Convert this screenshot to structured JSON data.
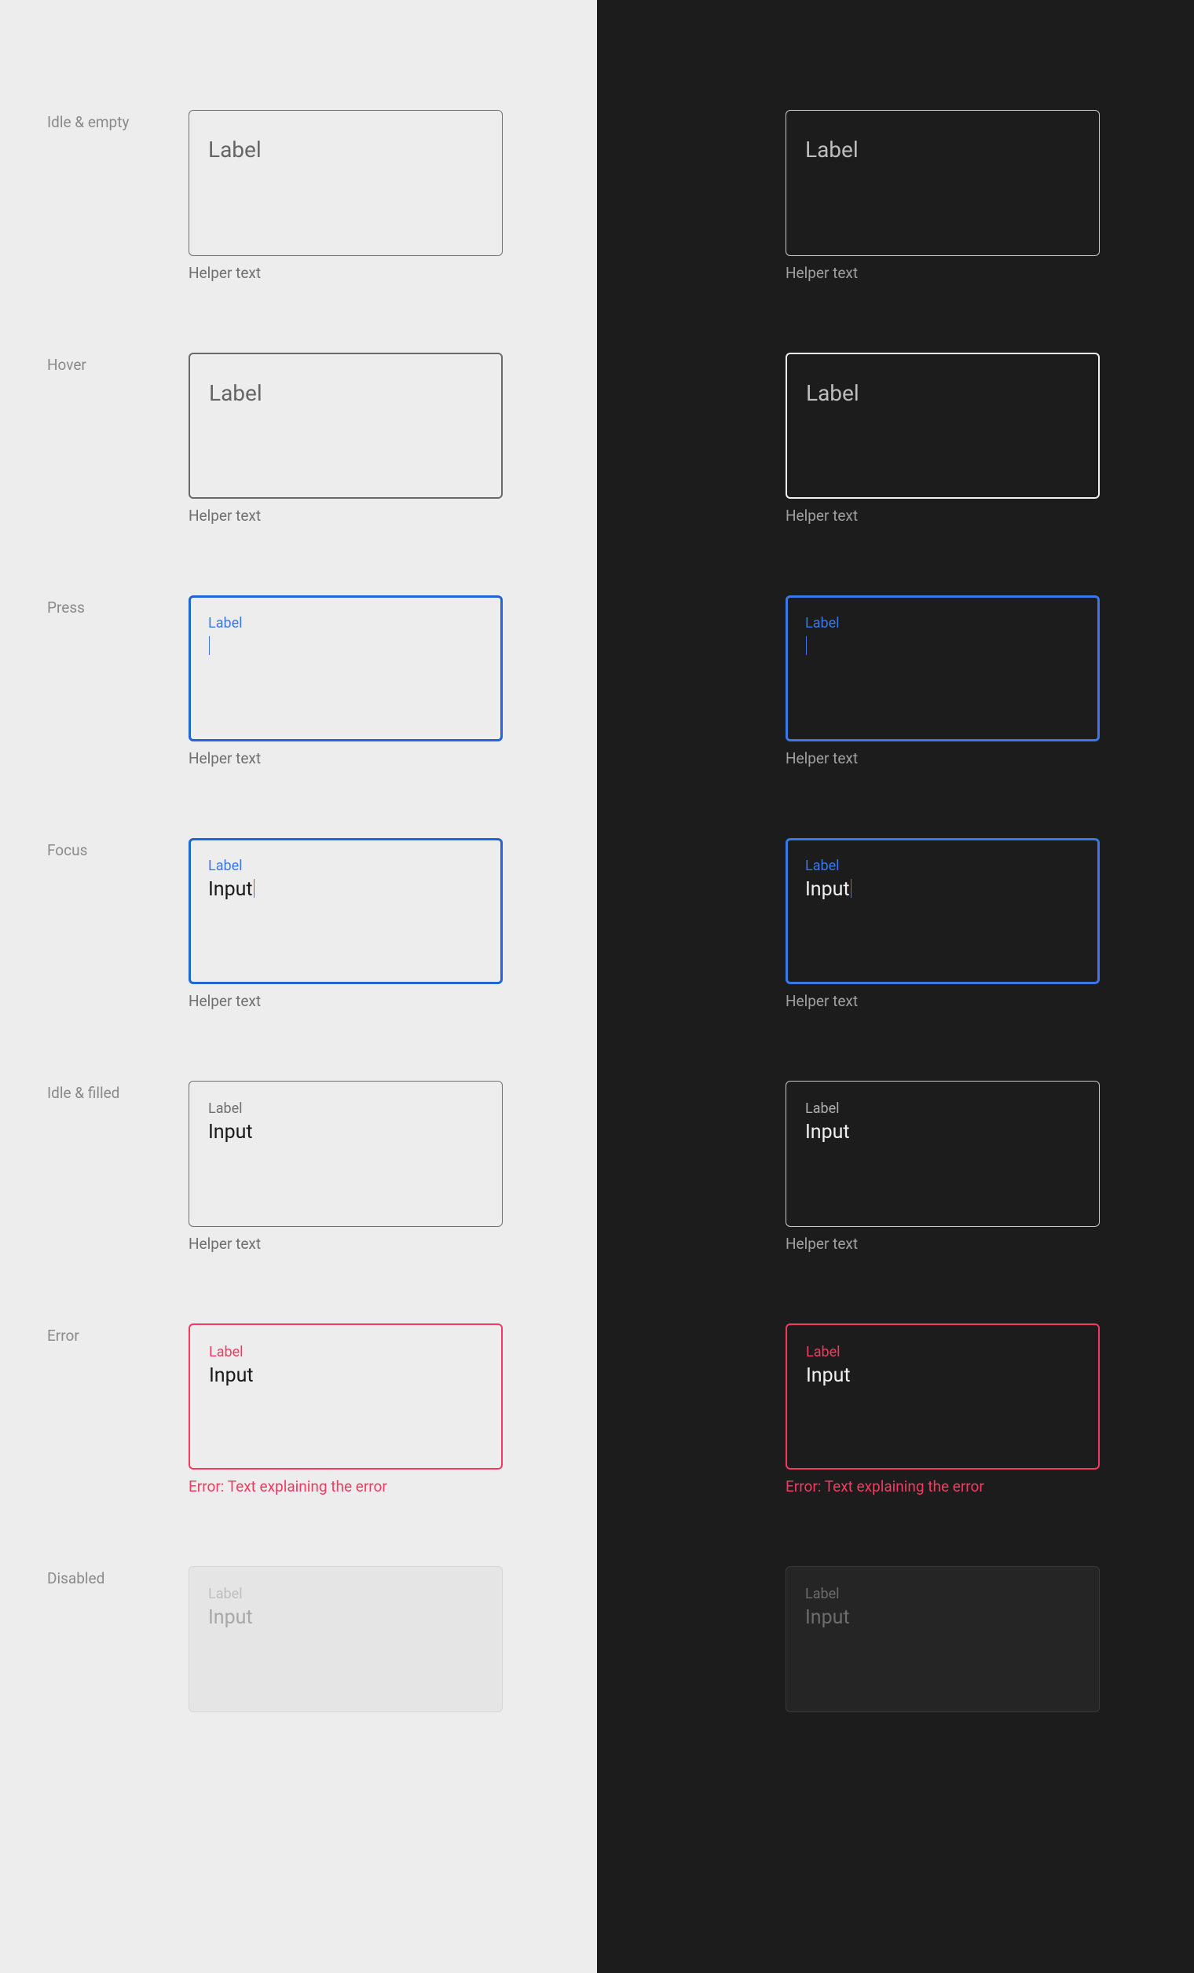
{
  "label_text": "Label",
  "input_text": "Input",
  "helper_text": "Helper text",
  "error_text": "Error: Text explaining the error",
  "states": {
    "idle_empty": "Idle & empty",
    "hover": "Hover",
    "press": "Press",
    "focus": "Focus",
    "idle_filled": "Idle & filled",
    "error": "Error",
    "disabled": "Disabled"
  },
  "colors": {
    "light_bg": "#ededed",
    "dark_bg": "#1c1c1c",
    "primary": "#2265d6",
    "primary_dark": "#3b78e7",
    "error": "#f33a63",
    "text_light": "#707070",
    "text_dark": "#b0b0b0",
    "input_light": "#1a1a1a",
    "input_dark": "#f0f0f0"
  }
}
